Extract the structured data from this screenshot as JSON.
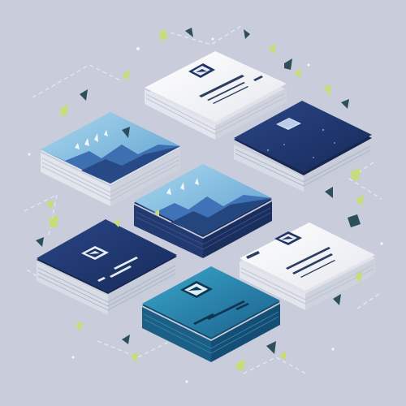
{
  "scene": {
    "description_visible_text": "",
    "palette": {
      "background": "#c9ccda",
      "navy": "#1f3568",
      "navy_dark": "#15274f",
      "sky": "#8cc6e3",
      "teal": "#1f7fa5",
      "white_card": "#f3f4f7",
      "leaf": "#c8dc7a",
      "leaf_dark": "#2d4f5c"
    }
  },
  "cards": [
    {
      "id": "card-top-white",
      "style": "white",
      "icon": "image-icon"
    },
    {
      "id": "card-right-navy",
      "style": "navy-glow",
      "icon": "square-icon"
    },
    {
      "id": "card-left-sky",
      "style": "mountain",
      "icon": ""
    },
    {
      "id": "card-center-sky",
      "style": "mountain",
      "icon": ""
    },
    {
      "id": "card-right-white",
      "style": "white",
      "icon": "image-icon"
    },
    {
      "id": "card-left-navy",
      "style": "navy",
      "icon": "image-icon"
    },
    {
      "id": "card-bottom-teal",
      "style": "teal",
      "icon": "image-icon"
    }
  ]
}
